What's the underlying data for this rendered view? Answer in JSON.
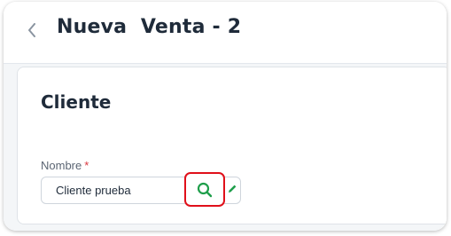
{
  "header": {
    "title": "Nueva  Venta - 2"
  },
  "card": {
    "title": "Cliente",
    "field": {
      "label": "Nombre",
      "required_mark": "*",
      "value": "Cliente prueba"
    }
  },
  "icons": {
    "back": "chevron-left-icon",
    "search": "search-icon",
    "edit": "pencil-icon"
  },
  "colors": {
    "accent_green": "#1e9e4a",
    "highlight_red": "#e0101a",
    "required_red": "#d9363e"
  }
}
